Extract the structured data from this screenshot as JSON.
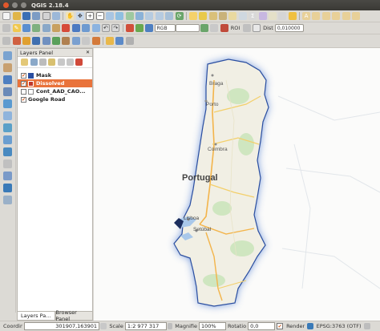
{
  "window": {
    "title": "QGIS 2.18.4"
  },
  "toolbar": {
    "raster_band_combo": "RGB",
    "roi_label": "ROI",
    "dist_label": "Dist",
    "dist_value": "0,010000"
  },
  "layers_panel": {
    "title": "Layers Panel",
    "layers": [
      {
        "name": "Mask",
        "checked": true,
        "swatch": "#2a4ea0",
        "selected": false
      },
      {
        "name": "Dissolved",
        "checked": true,
        "swatch": "#c0392b",
        "selected": true
      },
      {
        "name": "Cont_AAD_CAO...",
        "checked": false,
        "swatch": "#ffffff",
        "selected": false
      },
      {
        "name": "Google Road",
        "checked": true,
        "swatch": "",
        "selected": false
      }
    ]
  },
  "panel_tabs": [
    "Layers Pa...",
    "Browser Panel"
  ],
  "map": {
    "labels": [
      "Braga",
      "Porto",
      "Coimbra",
      "Portugal",
      "Lisboa",
      "Setúbal"
    ]
  },
  "status": {
    "coordinate_label": "Coordinate",
    "coordinate_value": "301907,163901",
    "scale_label": "Scale",
    "scale_value": "1:2 977 317",
    "magnifier_label": "Magnifie",
    "magnifier_value": "100%",
    "rotation_label": "Rotatio",
    "rotation_value": "0,0",
    "render_label": "Render",
    "crs_label": "EPSG:3763 (OTF)"
  },
  "colors": {
    "selection": "#e9733b",
    "titlebar": "#3c3b37",
    "mask": "#2a4ea0"
  }
}
